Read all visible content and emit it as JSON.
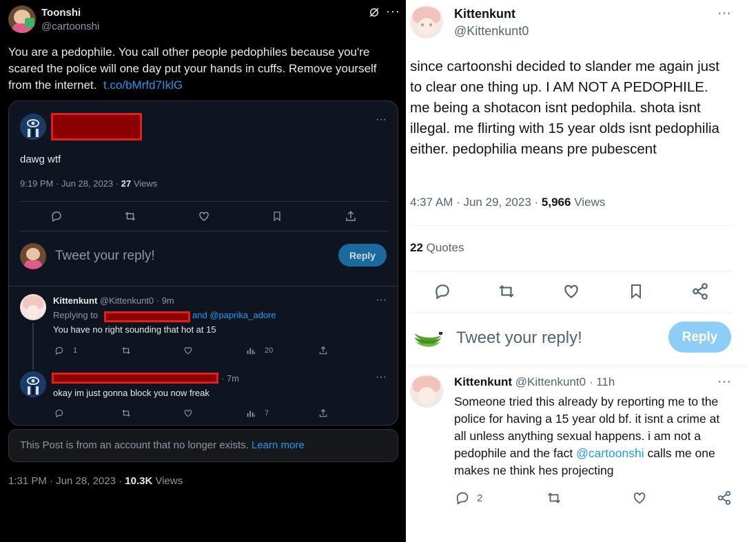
{
  "left": {
    "author_name": "Toonshi",
    "author_handle": "@cartoonshi",
    "tweet_text": "You are a pedophile. You call other people pedophiles because you're scared the police will one day put your hands in cuffs. Remove yourself from the internet.",
    "tweet_link": "t.co/bMrfd7IklG",
    "quoted": {
      "text": "dawg wtf",
      "time": "9:19 PM · Jun 28, 2023 ·",
      "views_count": "27",
      "views_label": "Views",
      "reply_placeholder": "Tweet your reply!",
      "reply_button": "Reply",
      "reply1": {
        "name": "Kittenkunt",
        "handle_time": "@Kittenkunt0 · 9m",
        "replying_to": "Replying to",
        "and_mention": "and @paprika_adore",
        "text": "You have no right sounding that hot at 15",
        "reply_count": "1",
        "view_count": "20"
      },
      "reply2": {
        "time": "· 7m",
        "text": "okay im just gonna block you now freak",
        "view_count": "7"
      }
    },
    "notice_text": "This Post is from an account that no longer exists.",
    "notice_link": "Learn more",
    "footer_time": "1:31 PM · Jun 28, 2023 ·",
    "footer_views_count": "10.3K",
    "footer_views_label": "Views"
  },
  "right": {
    "author_name": "Kittenkunt",
    "author_handle": "@Kittenkunt0",
    "tweet_text": "since cartoonshi decided to slander me again just to clear one thing up. I AM NOT A PEDOPHILE. me being a shotacon isnt pedophila. shota isnt illegal. me flirting with 15 year olds isnt pedophilia either. pedophilia means pre pubescent",
    "time": "4:37 AM · Jun 29, 2023 ·",
    "views_count": "5,966",
    "views_label": "Views",
    "quotes_count": "22",
    "quotes_label": "Quotes",
    "reply_placeholder": "Tweet your reply!",
    "reply_button": "Reply",
    "reply": {
      "name": "Kittenkunt",
      "handle_time": "@Kittenkunt0 · 11h",
      "text_before": "Someone tried this already by reporting me to the police for having a 15 year old bf. it isnt a crime at all unless anything sexual happens. i am not a pedophile and the fact ",
      "mention": "@cartoonshi",
      "text_after": " calls me one makes ne think hes projecting",
      "reply_count": "2"
    }
  },
  "colors": {
    "accent": "#1d9bf0",
    "redact": "#e0201e",
    "dark_bg": "#000000",
    "card_bg": "#0f1520"
  }
}
